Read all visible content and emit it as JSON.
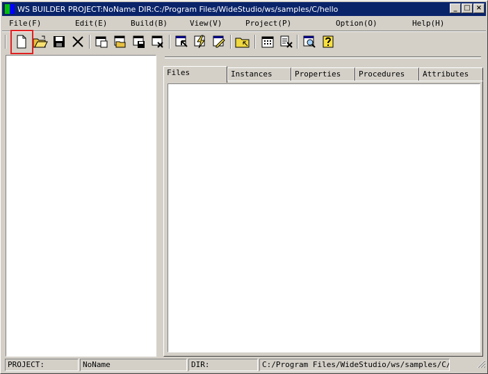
{
  "window": {
    "title": "WS BUILDER PROJECT:NoName DIR:C:/Program Files/WideStudio/ws/samples/C/hello",
    "controls": [
      "_",
      "□",
      "×"
    ]
  },
  "menu": [
    "File(F)",
    "Edit(E)",
    "Build(B)",
    "View(V)",
    "Project(P)",
    "Option(O)",
    "Help(H)"
  ],
  "toolbar": {
    "buttons": [
      "new-file-icon",
      "open-folder-icon",
      "save-disk-icon",
      "close-x-icon",
      "new-window-icon",
      "open-window-icon",
      "save-window-icon",
      "close-window-icon",
      "select-window-icon",
      "build-lightning-icon",
      "edit-window-icon",
      "folder-icon",
      "calendar-icon",
      "delete-instance-icon",
      "preview-icon",
      "help-question-icon"
    ],
    "highlighted": "new-file-icon"
  },
  "tabs": [
    "Files",
    "Instances",
    "Properties",
    "Procedures",
    "Attributes"
  ],
  "active_tab": "Files",
  "status": {
    "project_label": "PROJECT:",
    "project_value": "NoName",
    "dir_label": "DIR:",
    "dir_value": "C:/Program Files/WideStudio/ws/samples/C/hel"
  },
  "colors": {
    "titlebar": "#0a246a",
    "face": "#d4d0c8",
    "highlight_box": "#e02020"
  }
}
